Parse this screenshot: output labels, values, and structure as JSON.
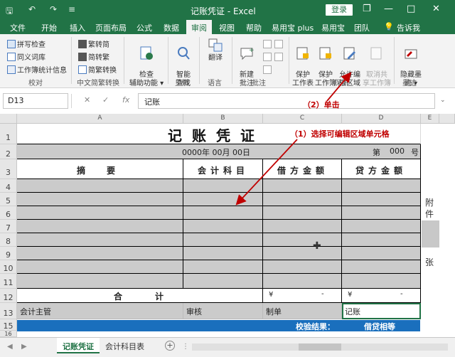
{
  "titlebar": {
    "title": "记账凭证  -  Excel",
    "login_label": "登录",
    "qa_save": "🖫",
    "qa_undo": "↶",
    "qa_redo": "↷",
    "qa_more": "≡",
    "win_restore": "❐",
    "win_minimize": "—",
    "win_maximize": "□",
    "win_close": "✕"
  },
  "tabs": [
    {
      "label": "文件"
    },
    {
      "label": "开始"
    },
    {
      "label": "插入"
    },
    {
      "label": "页面布局"
    },
    {
      "label": "公式"
    },
    {
      "label": "数据"
    },
    {
      "label": "审阅"
    },
    {
      "label": "视图"
    },
    {
      "label": "帮助"
    },
    {
      "label": "易用宝 plus"
    },
    {
      "label": "易用宝"
    },
    {
      "label": "团队"
    },
    {
      "label": "告诉我"
    }
  ],
  "ribbon": {
    "proofing": {
      "spell": "拼写检查",
      "thesaurus": "同义词库",
      "stats": "工作簿统计信息",
      "group": "校对"
    },
    "chinese": {
      "to_simple": "繁转简",
      "to_trad": "简转繁",
      "convert": "简繁转换",
      "group": "中文简繁转换"
    },
    "accessibility": {
      "check": "检查\n辅助功能 ▾",
      "group": "辅助功能"
    },
    "insights": {
      "smart": "智能\n查找",
      "group": "见解"
    },
    "language": {
      "translate": "翻译",
      "group": "语言"
    },
    "comments": {
      "new": "新建\n批注",
      "group": "批注"
    },
    "protect": {
      "sheet": "保护\n工作表",
      "workbook": "保护\n工作簿",
      "allow": "允许编\n辑区域",
      "unshare": "取消共\n享工作簿",
      "group": "保护"
    },
    "ink": {
      "hide": "隐藏墨\n迹 ▾",
      "group": "墨迹"
    }
  },
  "formula_bar": {
    "name_box": "D13",
    "cancel": "✕",
    "enter": "✓",
    "fx": "fx",
    "content": "记账"
  },
  "sheet": {
    "columns": [
      "A",
      "B",
      "C",
      "D",
      "E"
    ],
    "rows": [
      "1",
      "2",
      "3",
      "4",
      "5",
      "6",
      "7",
      "8",
      "9",
      "10",
      "11",
      "12",
      "13",
      "15",
      "16"
    ],
    "title": "记账凭证",
    "date_row": {
      "date": "0000年   00月     00日",
      "no_label": "第",
      "no_value": "000",
      "no_suffix": "号"
    },
    "headers": {
      "summary": "摘要",
      "account": "会计科目",
      "debit": "借方金额",
      "credit": "贷方金额"
    },
    "total_label": "合计",
    "debit_total": "¥",
    "debit_dash": "-",
    "credit_total": "¥",
    "credit_dash": "-",
    "sign": {
      "supervisor": "会计主管",
      "review": "审核",
      "prepare": "制单",
      "record": "记账"
    },
    "attach": {
      "line1": "附",
      "line2": "件",
      "line3": "张"
    },
    "check_row": {
      "result": "校验结果：",
      "balance": "借贷相等"
    }
  },
  "annotations": {
    "select": "（1）选择可编辑区域单元格",
    "click": "（2）单击"
  },
  "sheet_tabs": [
    {
      "label": "记账凭证",
      "active": true
    },
    {
      "label": "会计科目表",
      "active": false
    }
  ],
  "sheet_nav": {
    "prev": "◀",
    "next": "▶",
    "add": "+"
  },
  "colors": {
    "excel_green": "#217346",
    "annotation_red": "#c00000",
    "cell_gray": "#cbcbcb",
    "check_blue": "#1a6fbd"
  }
}
